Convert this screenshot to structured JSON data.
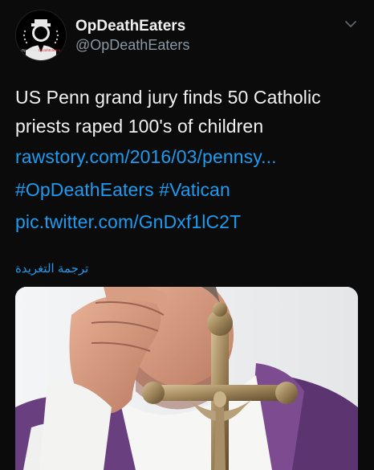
{
  "account": {
    "display_name": "OpDeathEaters",
    "handle": "@OpDeathEaters",
    "avatar_caption_white": "Operation",
    "avatar_caption_red": "DeathEaters"
  },
  "tweet": {
    "line1": "US Penn grand jury finds 50 Catholic",
    "line2": "priests raped 100's of children",
    "link": "rawstory.com/2016/03/pennsy...",
    "hashtag1": "#OpDeathEaters",
    "hashtag2": "#Vatican",
    "pic_link": "pic.twitter.com/GnDxf1lC2T",
    "translate_label": "ترجمة التغريدة"
  },
  "icons": {
    "menu": "chevron-down-icon",
    "avatar": "anonymous-mask-logo"
  },
  "colors": {
    "background": "#0b0b0b",
    "link": "#1d9bf0",
    "text": "#f1f1f1",
    "secondary": "#8b98a5"
  }
}
